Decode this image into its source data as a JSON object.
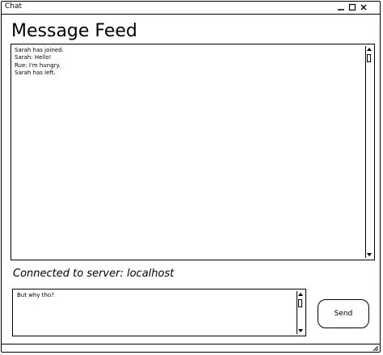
{
  "window": {
    "title": "Chat"
  },
  "heading": "Message Feed",
  "feed": {
    "messages": [
      "Sarah has joined.",
      "Sarah: Hello!",
      "Rue: I'm hungry.",
      "Sarah has left."
    ]
  },
  "status": "Connected to server: localhost",
  "composer": {
    "value": "But why tho?"
  },
  "send_label": "Send"
}
